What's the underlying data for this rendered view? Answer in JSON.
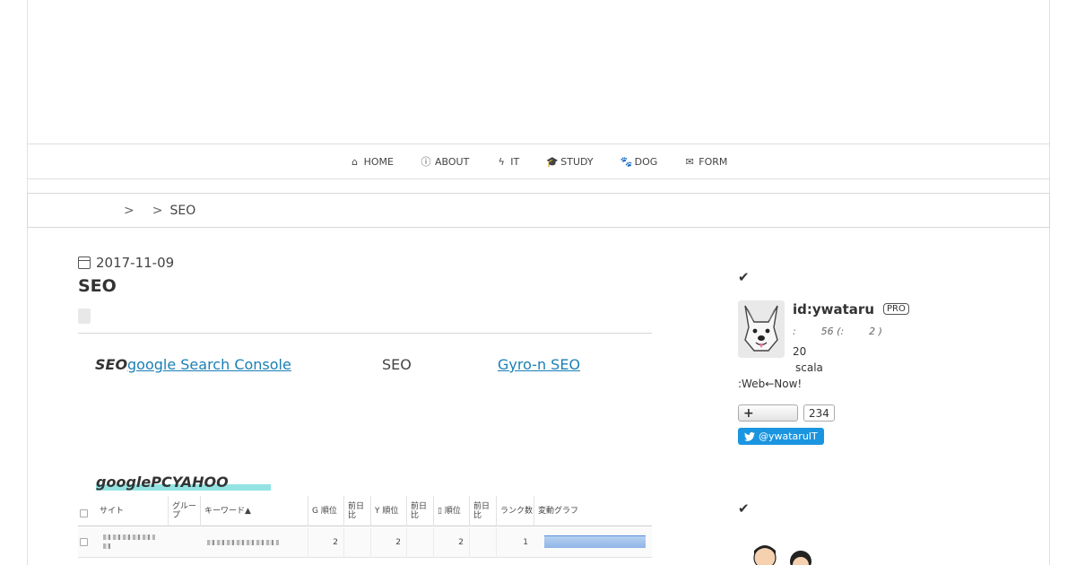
{
  "nav": {
    "items": [
      {
        "label": "HOME",
        "icon": "home-icon",
        "glyph": "⌂"
      },
      {
        "label": "ABOUT",
        "icon": "info-icon",
        "glyph": "ⓘ"
      },
      {
        "label": "IT",
        "icon": "bolt-icon",
        "glyph": "ϟ"
      },
      {
        "label": "STUDY",
        "icon": "graduation-cap-icon",
        "glyph": "🎓"
      },
      {
        "label": "DOG",
        "icon": "paw-icon",
        "glyph": "🐾"
      },
      {
        "label": "FORM",
        "icon": "envelope-icon",
        "glyph": "✉"
      }
    ]
  },
  "breadcrumb": {
    "sep": ">",
    "current": "SEO"
  },
  "article": {
    "date": "2017-11-09",
    "title": "SEO",
    "intro": {
      "bold": "SEO",
      "link1": "google Search Console",
      "plain": "SEO",
      "link2": "Gyro-n SEO"
    },
    "heading": "googlePCYAHOO",
    "table": {
      "headers": [
        "サイト",
        "グループ",
        "キーワード▲",
        "G 順位",
        "前日比",
        "Y 順位",
        "前日比",
        "▯ 順位",
        "前日比",
        "ランク数",
        "変動グラフ"
      ],
      "row": {
        "g_rank": "2",
        "y_rank": "2",
        "m_rank": "2",
        "rank_count": "1"
      }
    }
  },
  "sidebar": {
    "check": "✔",
    "profile": {
      "id": "id:ywataru",
      "badge": "PRO",
      "meta": ":        56 (:        2 )",
      "desc1": "20",
      "desc2": "scala",
      "desc3": ":Web←Now!",
      "follow": "+",
      "count": "234",
      "twitter": "@ywataruIT"
    }
  }
}
